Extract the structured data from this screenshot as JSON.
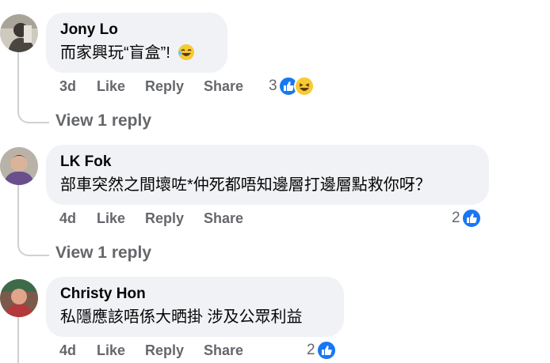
{
  "comments": [
    {
      "name": "Jony Lo",
      "text": "而家興玩“盲盒”!",
      "time": "3d",
      "like": "Like",
      "reply": "Reply",
      "share": "Share",
      "reaction_count": "3",
      "reactions": [
        "like-icon",
        "haha-icon"
      ],
      "view_replies": "View 1 reply"
    },
    {
      "name": "LK Fok",
      "text": "部車突然之間壞咗*仲死都唔知邊層打邊層點救你呀？",
      "time": "4d",
      "like": "Like",
      "reply": "Reply",
      "share": "Share",
      "reaction_count": "2",
      "reactions": [
        "like-icon"
      ],
      "view_replies": "View 1 reply"
    },
    {
      "name": "Christy Hon",
      "text": "私隱應該唔係大晒掛 涉及公眾利益",
      "time": "4d",
      "like": "Like",
      "reply": "Reply",
      "share": "Share",
      "reaction_count": "2",
      "reactions": [
        "like-icon"
      ]
    }
  ],
  "colors": {
    "like_blue": "#1877f2",
    "haha_yellow": "#f7c934",
    "bubble_bg": "#f0f2f5",
    "meta_gray": "#65676b"
  }
}
